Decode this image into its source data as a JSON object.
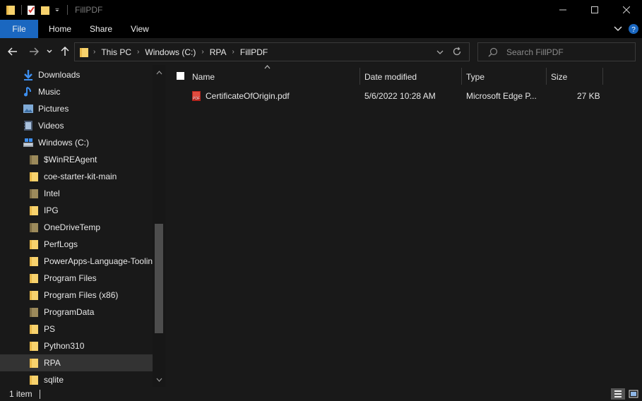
{
  "window": {
    "title": "FillPDF"
  },
  "ribbon": {
    "tabs": [
      "File",
      "Home",
      "Share",
      "View"
    ]
  },
  "address": {
    "crumbs": [
      "This PC",
      "Windows (C:)",
      "RPA",
      "FillPDF"
    ]
  },
  "search": {
    "placeholder": "Search FillPDF"
  },
  "nav": {
    "items": [
      {
        "label": "Downloads",
        "icon": "download-arrow-icon"
      },
      {
        "label": "Music",
        "icon": "music-note-icon"
      },
      {
        "label": "Pictures",
        "icon": "pictures-icon"
      },
      {
        "label": "Videos",
        "icon": "videos-icon"
      },
      {
        "label": "Windows (C:)",
        "icon": "drive-icon"
      },
      {
        "label": "$WinREAgent",
        "icon": "folder-icon"
      },
      {
        "label": "coe-starter-kit-main",
        "icon": "folder-icon"
      },
      {
        "label": "Intel",
        "icon": "folder-icon"
      },
      {
        "label": "IPG",
        "icon": "folder-icon"
      },
      {
        "label": "OneDriveTemp",
        "icon": "folder-icon"
      },
      {
        "label": "PerfLogs",
        "icon": "folder-icon"
      },
      {
        "label": "PowerApps-Language-Tooling",
        "icon": "folder-icon"
      },
      {
        "label": "Program Files",
        "icon": "folder-icon"
      },
      {
        "label": "Program Files (x86)",
        "icon": "folder-icon"
      },
      {
        "label": "ProgramData",
        "icon": "folder-icon"
      },
      {
        "label": "PS",
        "icon": "folder-icon"
      },
      {
        "label": "Python310",
        "icon": "folder-icon"
      },
      {
        "label": "RPA",
        "icon": "folder-icon"
      },
      {
        "label": "sqlite",
        "icon": "folder-icon"
      }
    ]
  },
  "columns": {
    "name": "Name",
    "date": "Date modified",
    "type": "Type",
    "size": "Size"
  },
  "files": [
    {
      "name": "CertificateOfOrigin.pdf",
      "date": "5/6/2022 10:28 AM",
      "type": "Microsoft Edge P...",
      "size": "27 KB"
    }
  ],
  "status": {
    "item_count": "1 item"
  },
  "colors": {
    "accent": "#1a67c0",
    "folder": "#f7d26d",
    "folder_dim": "#9c8a5b",
    "background": "#191919"
  }
}
